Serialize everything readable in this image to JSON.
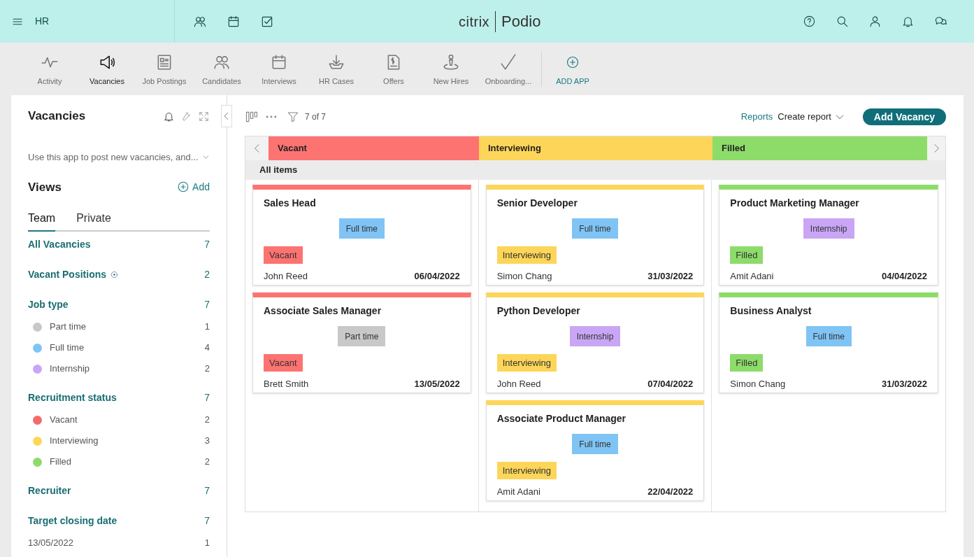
{
  "topbar": {
    "workspace": "HR",
    "logo_left": "citrix",
    "logo_right": "Podio"
  },
  "apps": [
    {
      "label": "Activity",
      "selected": false
    },
    {
      "label": "Vacancies",
      "selected": true
    },
    {
      "label": "Job Postings",
      "selected": false
    },
    {
      "label": "Candidates",
      "selected": false
    },
    {
      "label": "Interviews",
      "selected": false
    },
    {
      "label": "HR Cases",
      "selected": false
    },
    {
      "label": "Offers",
      "selected": false
    },
    {
      "label": "New Hires",
      "selected": false
    },
    {
      "label": "Onboarding...",
      "selected": false
    }
  ],
  "add_app": "ADD APP",
  "sidebar": {
    "title": "Vacancies",
    "description": "Use this app to post new vacancies, and...",
    "views_title": "Views",
    "add_label": "Add",
    "tabs": [
      {
        "label": "Team",
        "selected": true
      },
      {
        "label": "Private",
        "selected": false
      }
    ],
    "groups": [
      {
        "label": "All Vacancies",
        "count": "7"
      },
      {
        "label": "Vacant Positions",
        "count": "2",
        "info": true
      },
      {
        "label": "Job type",
        "count": "7",
        "items": [
          {
            "label": "Part time",
            "count": "1",
            "color": "#c8c8c8"
          },
          {
            "label": "Full time",
            "count": "4",
            "color": "#7fc4f5"
          },
          {
            "label": "Internship",
            "count": "2",
            "color": "#c9a6f5"
          }
        ]
      },
      {
        "label": "Recruitment status",
        "count": "7",
        "items": [
          {
            "label": "Vacant",
            "count": "2",
            "color": "#f26b6b"
          },
          {
            "label": "Interviewing",
            "count": "3",
            "color": "#fdd659"
          },
          {
            "label": "Filled",
            "count": "2",
            "color": "#8ddc6a"
          }
        ]
      },
      {
        "label": "Recruiter",
        "count": "7"
      },
      {
        "label": "Target closing date",
        "count": "7",
        "items": [
          {
            "label": "13/05/2022",
            "count": "1"
          }
        ]
      }
    ]
  },
  "toolbar": {
    "filter_count": "7 of 7",
    "reports": "Reports",
    "create_report": "Create report",
    "add_button": "Add Vacancy"
  },
  "board": {
    "section": "All items",
    "columns": [
      {
        "title": "Vacant",
        "color": "#fd7371",
        "cards": [
          {
            "title": "Sales Head",
            "type": {
              "label": "Full time",
              "color": "#7fc4f5"
            },
            "status": {
              "label": "Vacant",
              "color": "#fd7371"
            },
            "recruiter": "John Reed",
            "date": "06/04/2022"
          },
          {
            "title": "Associate Sales Manager",
            "type": {
              "label": "Part time",
              "color": "#c8c8c8"
            },
            "status": {
              "label": "Vacant",
              "color": "#fd7371"
            },
            "recruiter": "Brett Smith",
            "date": "13/05/2022"
          }
        ]
      },
      {
        "title": "Interviewing",
        "color": "#fdd659",
        "cards": [
          {
            "title": "Senior Developer",
            "type": {
              "label": "Full time",
              "color": "#7fc4f5"
            },
            "status": {
              "label": "Interviewing",
              "color": "#fdd659"
            },
            "recruiter": "Simon Chang",
            "date": "31/03/2022"
          },
          {
            "title": "Python Developer",
            "type": {
              "label": "Internship",
              "color": "#c9a6f5"
            },
            "status": {
              "label": "Interviewing",
              "color": "#fdd659"
            },
            "recruiter": "John Reed",
            "date": "07/04/2022"
          },
          {
            "title": "Associate Product Manager",
            "type": {
              "label": "Full time",
              "color": "#7fc4f5"
            },
            "status": {
              "label": "Interviewing",
              "color": "#fdd659"
            },
            "recruiter": "Amit Adani",
            "date": "22/04/2022"
          }
        ]
      },
      {
        "title": "Filled",
        "color": "#8ddc6a",
        "cards": [
          {
            "title": "Product Marketing Manager",
            "type": {
              "label": "Internship",
              "color": "#c9a6f5"
            },
            "status": {
              "label": "Filled",
              "color": "#8ddc6a"
            },
            "recruiter": "Amit Adani",
            "date": "04/04/2022"
          },
          {
            "title": "Business Analyst",
            "type": {
              "label": "Full time",
              "color": "#7fc4f5"
            },
            "status": {
              "label": "Filled",
              "color": "#8ddc6a"
            },
            "recruiter": "Simon Chang",
            "date": "31/03/2022"
          }
        ]
      }
    ]
  }
}
